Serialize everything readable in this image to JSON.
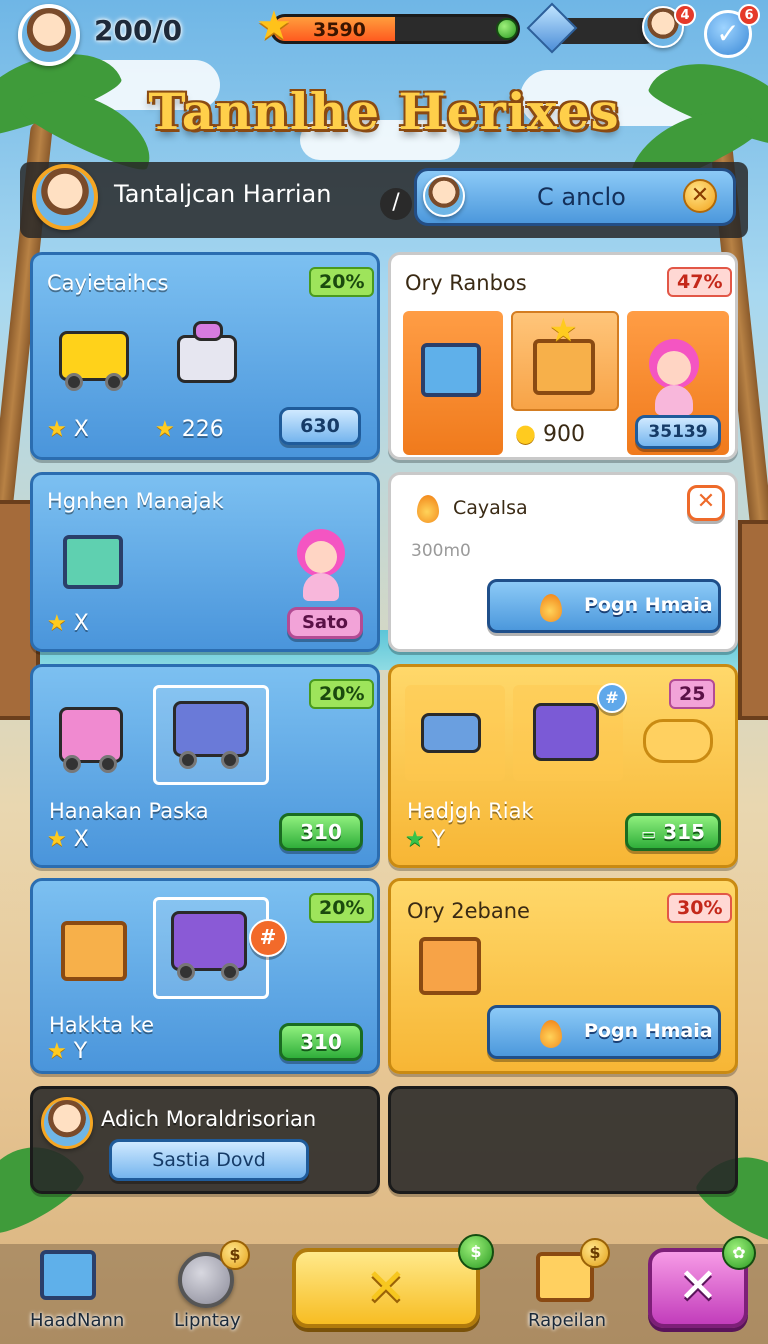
{
  "topbar": {
    "coins": "200/0",
    "star_progress_text": "3590",
    "star_progress_fraction": 0.5,
    "notif_avatar_count": "4",
    "notif_check_count": "6",
    "check_symbol": "✓"
  },
  "game_title": "Tannlhe Herixes",
  "player": {
    "name": "Tantaljcan Harrian",
    "cancel_label": "C anclo",
    "close_symbol": "✕"
  },
  "cards": [
    {
      "title": "Cayietaihcs",
      "badge": "20%",
      "star_value_1": "X",
      "star_value_2": "2⁠26",
      "button": "630"
    },
    {
      "title": "Ory Ranbos",
      "badge": "47%",
      "coin_value": "900",
      "button": "35139"
    },
    {
      "title": "Hgnhen Manajak",
      "star_value": "X",
      "button": "Sato"
    },
    {
      "title": "Cayalsa",
      "subtitle": "300m0",
      "close_symbol": "✕",
      "button": "Pogn Hmaia"
    },
    {
      "title": "Hanakan Paska",
      "badge": "20%",
      "star_value": "X",
      "button": "310"
    },
    {
      "title": "Hadjgh Riak",
      "badge": "25",
      "star_value": "Y",
      "button": "315",
      "hash_symbol": "#"
    },
    {
      "title": "Hakkta ke",
      "badge": "20%",
      "star_value": "Y",
      "button": "310",
      "hash_symbol": "#"
    },
    {
      "title": "Ory 2ebane",
      "badge": "30%",
      "button": "Pogn Hmaia"
    },
    {
      "title": "Adich Moraldrisorian",
      "button": "Sastia Dovd"
    }
  ],
  "bottom_nav": {
    "left_label": "HaadNann",
    "second_label": "Lipntay",
    "fourth_label": "Rapeilan",
    "coin_symbol": "$",
    "center_symbol": "✕",
    "pink_symbol": "✕"
  },
  "colors": {
    "accent_blue": "#4a95db",
    "accent_gold": "#f7b635",
    "badge_green": "#9ee45b",
    "badge_red": "#e25747",
    "title_gold": "#ffcf4a"
  }
}
